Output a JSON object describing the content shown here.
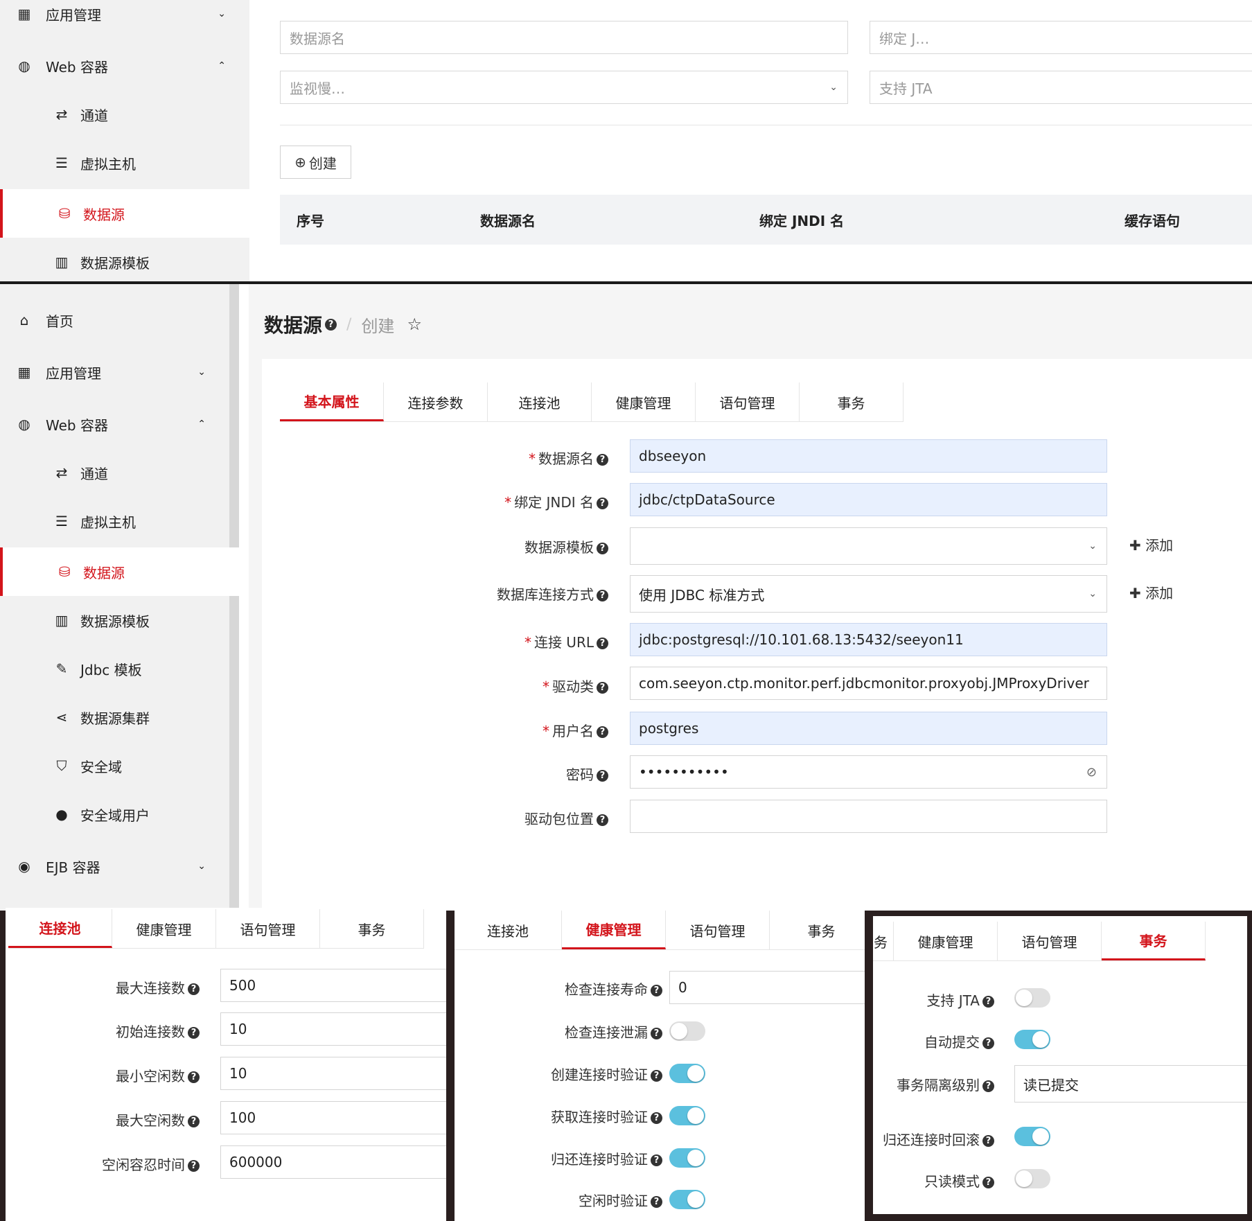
{
  "panelA": {
    "sidebar": [
      {
        "label": "应用管理",
        "icon": "grid-icon",
        "chevron": "down"
      },
      {
        "label": "Web 容器",
        "icon": "globe-icon",
        "chevron": "up"
      },
      {
        "label": "通道",
        "icon": "exchange-icon"
      },
      {
        "label": "虚拟主机",
        "icon": "server-icon"
      },
      {
        "label": "数据源",
        "icon": "database-icon",
        "active": true
      },
      {
        "label": "数据源模板",
        "icon": "building-icon"
      }
    ],
    "filters": {
      "datasource_name": "数据源名",
      "bind_jndi": "绑定 J…",
      "monitor_slow": "监视慢…",
      "support_jta": "支持 JTA"
    },
    "create_button": "创建",
    "table_headers": [
      "序号",
      "数据源名",
      "绑定 JNDI 名",
      "缓存语句"
    ]
  },
  "panelB": {
    "sidebar": [
      {
        "label": "首页",
        "icon": "home-icon"
      },
      {
        "label": "应用管理",
        "icon": "grid-icon",
        "chevron": "down"
      },
      {
        "label": "Web 容器",
        "icon": "globe-icon",
        "chevron": "up"
      },
      {
        "label": "通道",
        "icon": "exchange-icon"
      },
      {
        "label": "虚拟主机",
        "icon": "server-icon"
      },
      {
        "label": "数据源",
        "icon": "database-icon",
        "active": true
      },
      {
        "label": "数据源模板",
        "icon": "building-icon"
      },
      {
        "label": "Jdbc 模板",
        "icon": "edit-icon"
      },
      {
        "label": "数据源集群",
        "icon": "share-icon"
      },
      {
        "label": "安全域",
        "icon": "shield-icon"
      },
      {
        "label": "安全域用户",
        "icon": "user-icon"
      },
      {
        "label": "EJB 容器",
        "icon": "target-icon",
        "chevron": "down"
      }
    ],
    "breadcrumb": {
      "title": "数据源",
      "current": "创建"
    },
    "tabs": [
      "基本属性",
      "连接参数",
      "连接池",
      "健康管理",
      "语句管理",
      "事务"
    ],
    "active_tab": "基本属性",
    "fields": [
      {
        "label": "数据源名",
        "required": true,
        "value": "dbseeyon",
        "filled": true
      },
      {
        "label": "绑定 JNDI 名",
        "required": true,
        "value": "jdbc/ctpDataSource",
        "filled": true
      },
      {
        "label": "数据源模板",
        "required": false,
        "value": "",
        "type": "select",
        "add": "添加"
      },
      {
        "label": "数据库连接方式",
        "required": false,
        "value": "使用 JDBC 标准方式",
        "type": "select",
        "add": "添加"
      },
      {
        "label": "连接 URL",
        "required": true,
        "value": "jdbc:postgresql://10.101.68.13:5432/seeyon11",
        "filled": true
      },
      {
        "label": "驱动类",
        "required": true,
        "value": "com.seeyon.ctp.monitor.perf.jdbcmonitor.proxyobj.JMProxyDriver"
      },
      {
        "label": "用户名",
        "required": true,
        "value": "postgres",
        "filled": true
      },
      {
        "label": "密码",
        "required": false,
        "value": "•••••••••••",
        "type": "password"
      },
      {
        "label": "驱动包位置",
        "required": false,
        "value": ""
      }
    ]
  },
  "poolCard": {
    "tabs": [
      "连接池",
      "健康管理",
      "语句管理",
      "事务"
    ],
    "active_tab": "连接池",
    "fields": [
      {
        "label": "最大连接数",
        "value": "500"
      },
      {
        "label": "初始连接数",
        "value": "10"
      },
      {
        "label": "最小空闲数",
        "value": "10"
      },
      {
        "label": "最大空闲数",
        "value": "100"
      },
      {
        "label": "空闲容忍时间",
        "value": "600000"
      }
    ]
  },
  "healthCard": {
    "tabs": [
      "连接池",
      "健康管理",
      "语句管理",
      "事务"
    ],
    "active_tab": "健康管理",
    "check_lifetime": {
      "label": "检查连接寿命",
      "value": "0"
    },
    "toggles": [
      {
        "label": "检查连接泄漏",
        "on": false
      },
      {
        "label": "创建连接时验证",
        "on": true
      },
      {
        "label": "获取连接时验证",
        "on": true
      },
      {
        "label": "归还连接时验证",
        "on": true
      },
      {
        "label": "空闲时验证",
        "on": true
      }
    ]
  },
  "txCard": {
    "tabs": [
      "务",
      "健康管理",
      "语句管理",
      "事务"
    ],
    "active_tab": "事务",
    "toggles": [
      {
        "label": "支持 JTA",
        "on": false
      },
      {
        "label": "自动提交",
        "on": true
      }
    ],
    "isolation": {
      "label": "事务隔离级别",
      "value": "读已提交"
    },
    "toggles2": [
      {
        "label": "归还连接时回滚",
        "on": true
      },
      {
        "label": "只读模式",
        "on": false
      }
    ]
  },
  "colors": {
    "accent": "#d3141b",
    "toggle_on": "#5bc0de",
    "filled_input": "#e8f0fe"
  }
}
